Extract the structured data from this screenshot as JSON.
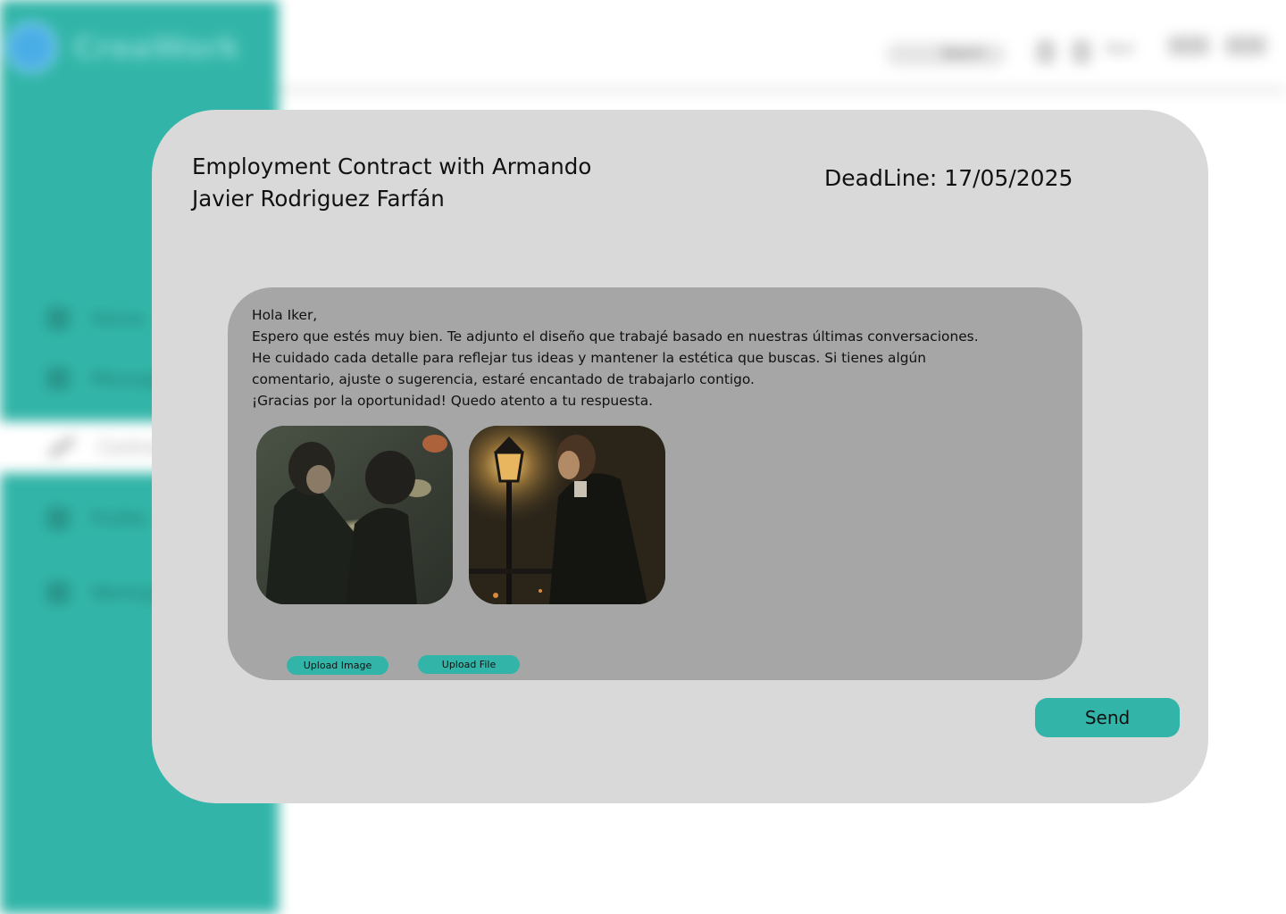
{
  "background": {
    "brand_label": "CreaWork",
    "search_label": "Search",
    "user_name": "Iker",
    "sidebar_items": [
      {
        "label": "Home"
      },
      {
        "label": "Messages"
      },
      {
        "label": "Contracts"
      },
      {
        "label": "Profile"
      },
      {
        "label": "Workspace"
      }
    ]
  },
  "modal": {
    "title": "Employment Contract with Armando Javier Rodriguez Farfán",
    "deadline": "DeadLine: 17/05/2025",
    "message": {
      "greeting": "Hola Iker,",
      "line1": "Espero que estés muy bien. Te adjunto el diseño que trabajé basado en nuestras últimas conversaciones.",
      "line2": "He cuidado cada detalle para reflejar tus ideas y mantener la estética que buscas. Si tienes algún",
      "line3": "comentario, ajuste o sugerencia, estaré encantado de trabajarlo contigo.",
      "line4": "¡Gracias por la oportunidad! Quedo atento a tu respuesta."
    },
    "attachments": [
      {
        "alt": "painting-two-figures"
      },
      {
        "alt": "painting-man-with-streetlamp"
      }
    ],
    "upload_image_label": "Upload Image",
    "upload_file_label": "Upload File",
    "send_label": "Send"
  },
  "colors": {
    "accent": "#32b5a8",
    "modal_bg": "#d9d9d9",
    "message_bg": "#a6a6a6"
  }
}
